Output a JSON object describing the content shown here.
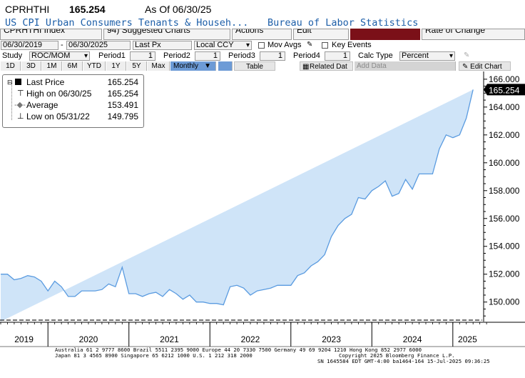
{
  "header": {
    "ticker": "CPRHTHI",
    "last_value": "165.254",
    "as_of": "As Of 06/30/25",
    "name": "US CPI Urban Consumers Tenants & Househ...",
    "source": "Bureau of Labor Statistics"
  },
  "toolbar_top": {
    "security": "CPRHTHI Index",
    "suggested": "94) Suggested Charts",
    "actions": "Actions",
    "edit": "Edit",
    "rate_of_change": "Rate of Change"
  },
  "toolbar": {
    "date_from": "06/30/2019",
    "date_sep": "-",
    "date_to": "06/30/2025",
    "field": "Last Px",
    "currency": "Local CCY",
    "mov_avgs": "Mov Avgs",
    "key_events": "Key Events",
    "study_label": "Study",
    "study_value": "ROC/MOM",
    "period1_label": "Period1",
    "period1_value": "1",
    "period2_label": "Period2",
    "period2_value": "1",
    "period3_label": "Period3",
    "period3_value": "1",
    "period4_label": "Period4",
    "period4_value": "1",
    "calc_type_label": "Calc Type",
    "calc_type_value": "Percent"
  },
  "buttons": {
    "ranges": [
      "1D",
      "3D",
      "1M",
      "6M",
      "YTD",
      "1Y",
      "5Y",
      "Max"
    ],
    "frequency": "Monthly",
    "table": "Table",
    "related": "Related Dat",
    "add_data": "Add Data",
    "edit_chart": "Edit Chart"
  },
  "legend": {
    "last_price_label": "Last Price",
    "last_price_value": "165.254",
    "high_label": "High on 06/30/25",
    "high_value": "165.254",
    "average_label": "Average",
    "average_value": "153.491",
    "low_label": "Low on 05/31/22",
    "low_value": "149.795"
  },
  "colors": {
    "line": "#5a9be0",
    "fill": "#cfe4f8",
    "price_tag": "#000000",
    "title_link": "#1c5ea8"
  },
  "footer": {
    "line1": "Australia 61 2 9777 8600 Brazil 5511 2395 9000 Europe 44 20 7330 7500 Germany 49 69 9204 1210 Hong Kong 852 2977 6000",
    "line2_left": "Japan 81 3 4565 8900        Singapore 65 6212 1000       U.S. 1 212 318 2000",
    "line2_right": "Copyright 2025 Bloomberg Finance L.P.",
    "line3": "SN 1645584 EDT  GMT-4:00 ba1464-164 15-Jul-2025 09:36:25"
  },
  "chart_data": {
    "type": "area",
    "x": [
      "2019-06",
      "2019-07",
      "2019-08",
      "2019-09",
      "2019-10",
      "2019-11",
      "2019-12",
      "2020-01",
      "2020-02",
      "2020-03",
      "2020-04",
      "2020-05",
      "2020-06",
      "2020-07",
      "2020-08",
      "2020-09",
      "2020-10",
      "2020-11",
      "2020-12",
      "2021-01",
      "2021-02",
      "2021-03",
      "2021-04",
      "2021-05",
      "2021-06",
      "2021-07",
      "2021-08",
      "2021-09",
      "2021-10",
      "2021-11",
      "2021-12",
      "2022-01",
      "2022-02",
      "2022-03",
      "2022-04",
      "2022-05",
      "2022-06",
      "2022-07",
      "2022-08",
      "2022-09",
      "2022-10",
      "2022-11",
      "2022-12",
      "2023-01",
      "2023-02",
      "2023-03",
      "2023-04",
      "2023-05",
      "2023-06",
      "2023-07",
      "2023-08",
      "2023-09",
      "2023-10",
      "2023-11",
      "2023-12",
      "2024-01",
      "2024-02",
      "2024-03",
      "2024-04",
      "2024-05",
      "2024-06",
      "2024-07",
      "2024-08",
      "2024-09",
      "2024-10",
      "2024-11",
      "2024-12",
      "2025-01",
      "2025-02",
      "2025-03",
      "2025-04",
      "2025-05",
      "2025-06"
    ],
    "values": [
      152.0,
      152.0,
      151.6,
      151.7,
      151.9,
      151.8,
      151.5,
      150.8,
      151.5,
      151.1,
      150.4,
      150.4,
      150.8,
      150.8,
      150.8,
      150.9,
      151.3,
      151.1,
      152.5,
      150.6,
      150.6,
      150.4,
      150.6,
      150.7,
      150.4,
      150.9,
      150.6,
      150.2,
      150.5,
      150.0,
      150.0,
      149.9,
      149.9,
      149.8,
      151.1,
      151.2,
      151.0,
      150.5,
      150.8,
      150.9,
      151.0,
      151.2,
      151.2,
      151.2,
      151.9,
      152.1,
      152.6,
      152.9,
      153.4,
      154.7,
      155.5,
      156.0,
      156.3,
      157.5,
      157.4,
      158.0,
      158.3,
      158.7,
      157.6,
      157.8,
      158.8,
      158.1,
      159.2,
      159.2,
      159.2,
      161.0,
      162.0,
      161.8,
      162.0,
      163.2,
      165.254
    ],
    "xlabels": [
      "2019",
      "2020",
      "2021",
      "2022",
      "2023",
      "2024",
      "2025"
    ],
    "yticks": [
      150.0,
      152.0,
      154.0,
      156.0,
      158.0,
      160.0,
      162.0,
      164.0,
      166.0
    ],
    "ylim": [
      148.6,
      166.3
    ],
    "last_value_label": "165.254",
    "grid": false,
    "legend_position": "top-left"
  }
}
